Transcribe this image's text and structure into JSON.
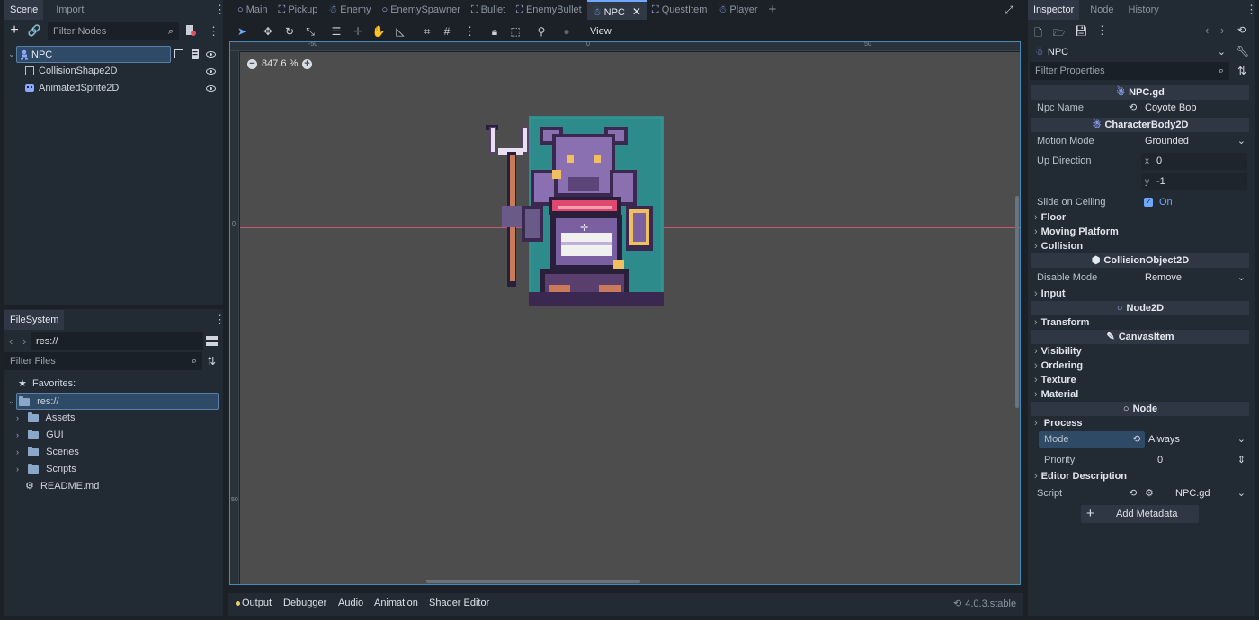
{
  "scene_dock": {
    "tabs": [
      "Scene",
      "Import"
    ],
    "filter_placeholder": "Filter Nodes",
    "tree": [
      {
        "label": "NPC",
        "icon": "character-body-icon",
        "selected": true
      },
      {
        "label": "CollisionShape2D",
        "icon": "collision-shape-icon"
      },
      {
        "label": "AnimatedSprite2D",
        "icon": "animated-sprite-icon"
      }
    ]
  },
  "filesystem": {
    "tab": "FileSystem",
    "path": "res://",
    "filter_placeholder": "Filter Files",
    "favorites_label": "Favorites:",
    "root_label": "res://",
    "folders": [
      "Assets",
      "GUI",
      "Scenes",
      "Scripts"
    ],
    "file": "README.md"
  },
  "editor": {
    "scene_tabs": [
      "Main",
      "Pickup",
      "Enemy",
      "EnemySpawner",
      "Bullet",
      "EnemyBullet",
      "NPC",
      "QuestItem",
      "Player"
    ],
    "active_tab": "NPC",
    "toolbar_view_label": "View",
    "zoom_label": "847.6 %",
    "ruler_labels_top": [
      "-50",
      "0",
      "50"
    ],
    "ruler_labels_left": [
      "0",
      "50"
    ]
  },
  "bottom_bar": {
    "tabs": [
      "Output",
      "Debugger",
      "Audio",
      "Animation",
      "Shader Editor"
    ],
    "version": "4.0.3.stable"
  },
  "inspector": {
    "tabs": [
      "Inspector",
      "Node",
      "History"
    ],
    "object_name": "NPC",
    "filter_placeholder": "Filter Properties",
    "script_section": "NPC.gd",
    "npc_name_label": "Npc Name",
    "npc_name_value": "Coyote Bob",
    "characterbody_section": "CharacterBody2D",
    "motion_mode_label": "Motion Mode",
    "motion_mode_value": "Grounded",
    "up_direction_label": "Up Direction",
    "up_x_label": "x",
    "up_x_value": "0",
    "up_y_label": "y",
    "up_y_value": "-1",
    "slide_label": "Slide on Ceiling",
    "slide_value": "On",
    "groups_a": [
      "Floor",
      "Moving Platform",
      "Collision"
    ],
    "collisionobject_section": "CollisionObject2D",
    "disable_mode_label": "Disable Mode",
    "disable_mode_value": "Remove",
    "group_input": "Input",
    "node2d_section": "Node2D",
    "group_transform": "Transform",
    "canvasitem_section": "CanvasItem",
    "groups_b": [
      "Visibility",
      "Ordering",
      "Texture",
      "Material"
    ],
    "node_section": "Node",
    "group_process": "Process",
    "mode_label": "Mode",
    "mode_value": "Always",
    "priority_label": "Priority",
    "priority_value": "0",
    "group_editor_desc": "Editor Description",
    "script_label": "Script",
    "script_value": "NPC.gd",
    "add_metadata_label": "Add Metadata"
  },
  "colors": {
    "accent": "#6ea8ff",
    "selection": "#2f4a66",
    "viewport_bg": "#4d4d4d",
    "axis_x": "#e06080",
    "axis_y": "#c8d080",
    "sprite_bg": "#2d8b8b"
  }
}
